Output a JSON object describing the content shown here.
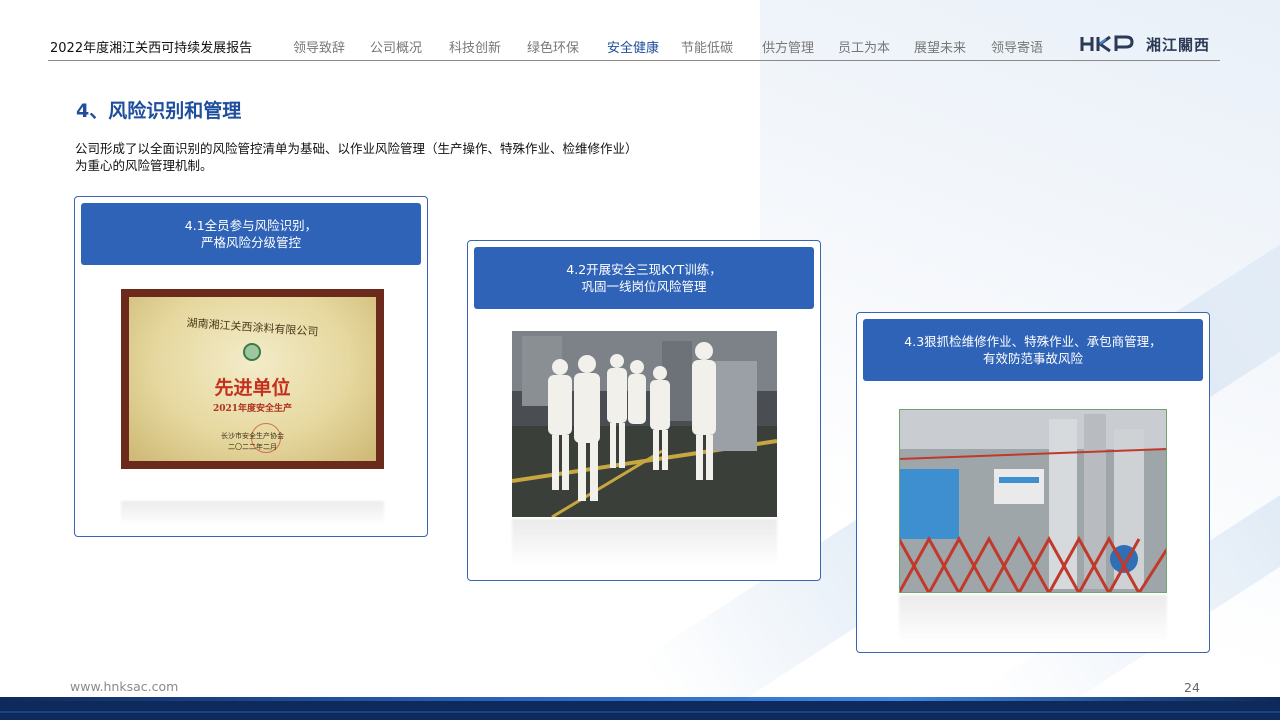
{
  "header": {
    "doc_title": "2022年度湘江关西可持续发展报告",
    "nav": [
      {
        "label": "领导致辞",
        "active": false
      },
      {
        "label": "公司概况",
        "active": false
      },
      {
        "label": "科技创新",
        "active": false
      },
      {
        "label": "绿色环保",
        "active": false
      },
      {
        "label": "安全健康",
        "active": true
      },
      {
        "label": "节能低碳",
        "active": false
      },
      {
        "label": "供方管理",
        "active": false
      },
      {
        "label": "员工为本",
        "active": false
      },
      {
        "label": "展望未来",
        "active": false
      },
      {
        "label": "领导寄语",
        "active": false
      }
    ],
    "logo": {
      "mark": "HKP",
      "text": "湘江關西"
    }
  },
  "section": {
    "title": "4、风险识别和管理",
    "intro_line1": "公司形成了以全面识别的风险管控清单为基础、以作业风险管理（生产操作、特殊作业、检维修作业）",
    "intro_line2": "为重心的风险管理机制。"
  },
  "cards": [
    {
      "title_line1": "4.1全员参与风险识别，",
      "title_line2": "严格风险分级管控",
      "plaque": {
        "company": "湖南湘江关西涂料有限公司",
        "main": "先进单位",
        "sub": "2021年度安全生产",
        "assoc": "长沙市安全生产协会",
        "date": "二〇二二年二月"
      }
    },
    {
      "title_line1": "4.2开展安全三现KYT训练，",
      "title_line2": "巩固一线岗位风险管理"
    },
    {
      "title_line1": "4.3狠抓检维修作业、特殊作业、承包商管理，",
      "title_line2": "有效防范事故风险"
    }
  ],
  "footer": {
    "url": "www.hnksac.com",
    "page": "24"
  },
  "colors": {
    "accent": "#1f4e9c",
    "card_head": "#2f63b8",
    "card_border": "#3a64b4",
    "footer_bar": "#0e2a5a"
  }
}
